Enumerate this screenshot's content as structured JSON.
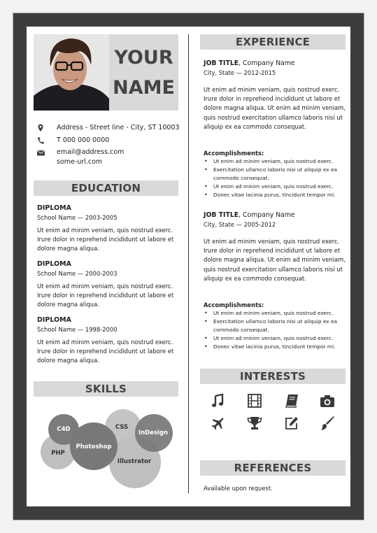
{
  "header": {
    "name_line1": "YOUR",
    "name_line2": "NAME",
    "photo": "portrait-photo"
  },
  "contact": {
    "address": {
      "icon": "map-marker-icon",
      "text": "Address - Street line - City, ST 10003"
    },
    "phone": {
      "icon": "phone-icon",
      "text": "T 000 000 0000"
    },
    "email": {
      "icon": "envelope-icon",
      "text": "email@address.com"
    },
    "url": {
      "text": "some-url.com"
    }
  },
  "education": {
    "title": "EDUCATION",
    "items": [
      {
        "degree": "DIPLOMA",
        "school": "School Name — 2003-2005",
        "desc": "Ut enim ad minim veniam, quis nostrud exerc. Irure dolor in reprehend incididunt ut labore et dolore magna aliqua."
      },
      {
        "degree": "DIPLOMA",
        "school": "School Name — 2000-2003",
        "desc": "Ut enim ad minim veniam, quis nostrud exerc. Irure dolor in reprehend incididunt ut labore et dolore magna aliqua."
      },
      {
        "degree": "DIPLOMA",
        "school": "School Name — 1998-2000",
        "desc": "Ut enim ad minim veniam, quis nostrud exerc. Irure dolor in reprehend incididunt ut labore et dolore magna aliqua."
      }
    ]
  },
  "skills": {
    "title": "SKILLS",
    "items": [
      {
        "label": "PHP",
        "shade": "light"
      },
      {
        "label": "C4D",
        "shade": "dark"
      },
      {
        "label": "Photoshop",
        "shade": "dark"
      },
      {
        "label": "CSS",
        "shade": "light"
      },
      {
        "label": "InDesign",
        "shade": "dark"
      },
      {
        "label": "Illustrator",
        "shade": "light"
      }
    ]
  },
  "experience": {
    "title": "EXPERIENCE",
    "jobs": [
      {
        "title": "JOB TITLE",
        "company": ", Company Name",
        "location": "City, State — 2012-2015",
        "desc": "Ut enim ad minim veniam, quis nostrud exerc. Irure dolor in reprehend incididunt ut labore et dolore magna aliqua. Ut enim ad minim veniam, quis nostrud exercitation ullamco laboris nisi ut aliquip ex ea commodo consequat.",
        "accomplishments_label": "Accomplishments:",
        "accomplishments": [
          "Ut enim ad minim veniam, quis nostrud exerc.",
          "Exercitation ullamco laboris nisi ut aliquip ex ea commodo consequat.",
          "Ut enim ad minim veniam, quis nostrud exerc.",
          "Donec vitae lacinia purus, tincidunt tempor mi."
        ]
      },
      {
        "title": "JOB TITLE",
        "company": ", Company Name",
        "location": "City, State — 2005-2012",
        "desc": "Ut enim ad minim veniam, quis nostrud exerc. Irure dolor in reprehend incididunt ut labore et dolore magna aliqua. Ut enim ad minim veniam, quis nostrud exercitation ullamco laboris nisi ut aliquip ex ea commodo consequat.",
        "accomplishments_label": "Accomplishments:",
        "accomplishments": [
          "Ut enim ad minim veniam, quis nostrud exerc.",
          "Exercitation ullamco laboris nisi ut aliquip ex ea commodo consequat.",
          "Ut enim ad minim veniam, quis nostrud exerc.",
          "Donec vitae lacinia purus, tincidunt tempor mi."
        ]
      }
    ]
  },
  "interests": {
    "title": "INTERESTS",
    "icons": [
      "music-note-icon",
      "film-icon",
      "book-icon",
      "camera-icon",
      "airplane-icon",
      "trophy-icon",
      "edit-icon",
      "paintbrush-icon"
    ]
  },
  "references": {
    "title": "REFERENCES",
    "text": "Available upon request."
  },
  "colors": {
    "frame": "#3d3d3b",
    "section_header_bg": "#d9d9d9",
    "heading_text": "#444444"
  }
}
